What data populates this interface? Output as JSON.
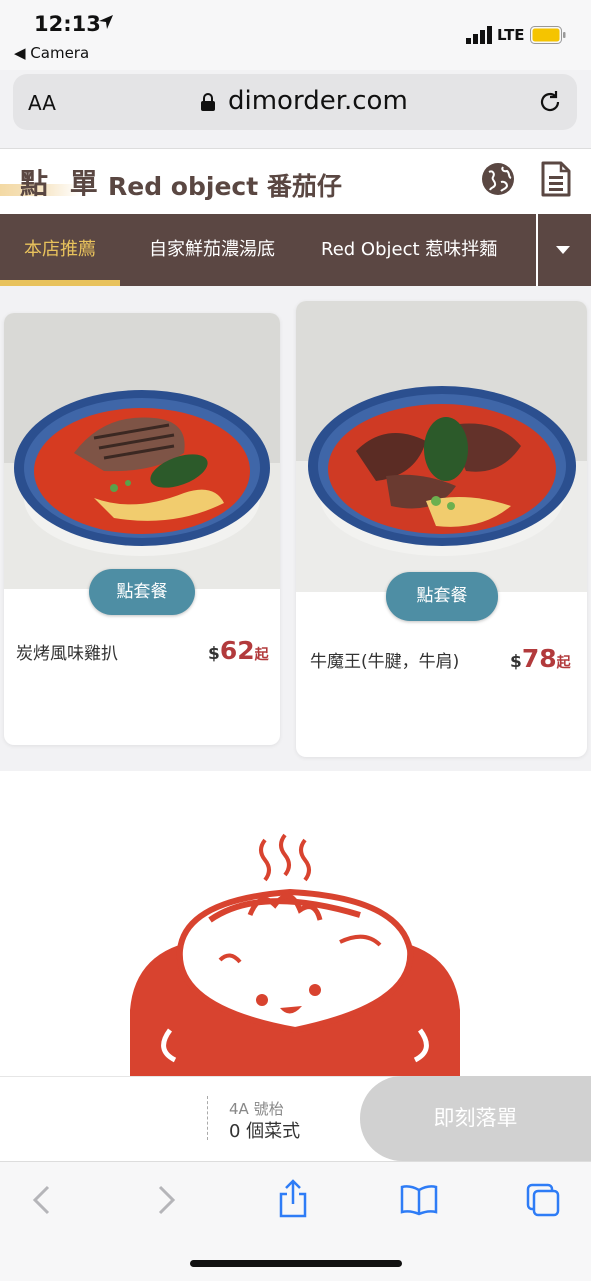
{
  "status_bar": {
    "time": "12:13",
    "back_app": "◀ Camera",
    "network": "LTE"
  },
  "browser": {
    "text_size_label": "AA",
    "url": "dimorder.com"
  },
  "header": {
    "title": "點 單",
    "shop_name": "Red object 番茄仔"
  },
  "tabs": [
    {
      "label": "本店推薦"
    },
    {
      "label": "自家鮮茄濃湯底"
    },
    {
      "label": "Red Object 惹味拌麵"
    }
  ],
  "products": [
    {
      "name": "炭烤風味雞扒",
      "currency": "$",
      "price": "62",
      "suffix": "起",
      "button": "點套餐"
    },
    {
      "name": "牛魔王(牛腱，牛肩)",
      "currency": "$",
      "price": "78",
      "suffix": "起",
      "button": "點套餐"
    }
  ],
  "order_bar": {
    "table": "4A 號枱",
    "count": "0 個菜式",
    "submit": "即刻落單"
  },
  "colors": {
    "brown": "#5b4743",
    "gold": "#e8c25c",
    "teal": "#4e8ea4",
    "price_red": "#b23a3c",
    "mascot_red": "#d8432f"
  }
}
